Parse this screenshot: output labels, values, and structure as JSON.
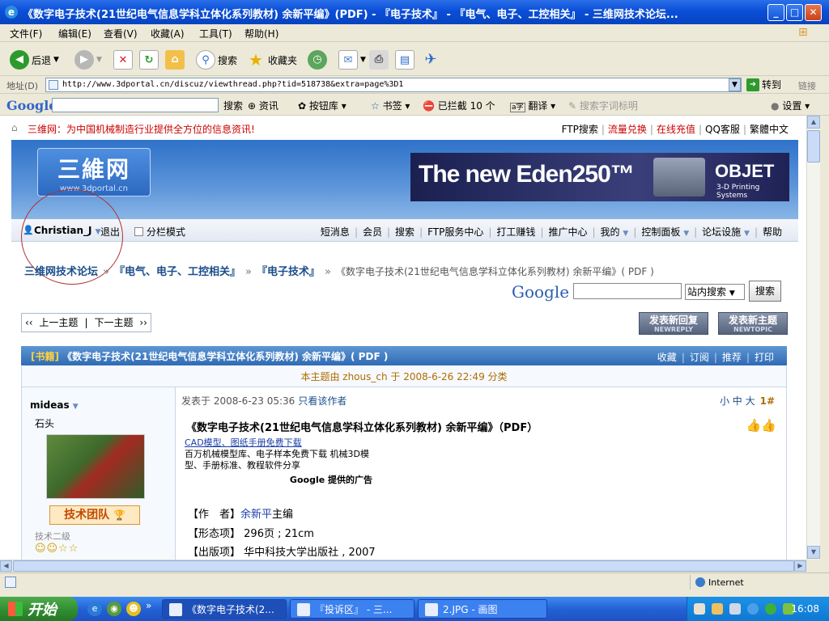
{
  "window": {
    "title": "《数字电子技术(21世纪电气信息学科立体化系列教材) 余新平编》(PDF) - 『电子技术』 - 『电气、电子、工控相关』 - 三维网技术论坛...",
    "min": "_",
    "max": "□",
    "close": "✕"
  },
  "menu": [
    "文件(F)",
    "编辑(E)",
    "查看(V)",
    "收藏(A)",
    "工具(T)",
    "帮助(H)"
  ],
  "toolbar": {
    "back": "后退",
    "search": "搜索",
    "favorites": "收藏夹"
  },
  "address": {
    "label": "地址(D)",
    "url": "http://www.3dportal.cn/discuz/viewthread.php?tid=518738&extra=page%3D1",
    "go": "转到",
    "links": "链接"
  },
  "google_toolbar": {
    "logo": "Google",
    "search": "搜索",
    "news": "资讯",
    "buttons": "按钮库",
    "bookmarks": "书签",
    "blocked": "已拦截 10 个",
    "translate": "翻译",
    "highlight": "搜索字词标明",
    "settings": "设置"
  },
  "site": {
    "slogan": "三维网：为中国机械制造行业提供全方位的信息资讯!",
    "top_links": [
      "FTP搜索",
      "流量兑换",
      "在线充值",
      "QQ客服",
      "繁體中文"
    ],
    "logo_text": "三維网",
    "logo_url": "www.3dportal.cn",
    "ad_headline": "The new Eden250™",
    "ad_brand": "OBJET",
    "ad_sub": "3-D Printing Systems",
    "user": "Christian_J",
    "logout": "退出",
    "split_mode": "分栏模式",
    "nav_links": [
      "短消息",
      "会员",
      "搜索",
      "FTP服务中心",
      "打工赚钱",
      "推广中心",
      "我的",
      "控制面板",
      "论坛设施",
      "帮助"
    ]
  },
  "breadcrumb": {
    "forum": "三维网技术论坛",
    "cat1": "『电气、电子、工控相关』",
    "cat2": "『电子技术』",
    "current": "《数字电子技术(21世纪电气信息学科立体化系列教材) 余新平编》( PDF )"
  },
  "search_box": {
    "logo": "Google",
    "select": "站内搜索",
    "button": "搜索"
  },
  "thread_nav": {
    "prev": "上一主题",
    "next": "下一主题",
    "reply": "发表新回复",
    "reply_en": "NEWREPLY",
    "new_topic": "发表新主题",
    "new_topic_en": "NEWTOPIC"
  },
  "thread": {
    "tag": "[书籍]",
    "title": "《数字电子技术(21世纪电气信息学科立体化系列教材) 余新平编》( PDF )",
    "actions": [
      "收藏",
      "订阅",
      "推荐",
      "打印"
    ],
    "moved": "本主题由 zhous_ch 于 2008-6-26 22:49 分类"
  },
  "poster": {
    "name": "mideas",
    "rank": "石头",
    "team": "技术团队",
    "level": "技术二级"
  },
  "post": {
    "posted": "发表于 2008-6-23 05:36",
    "author_only": "只看该作者",
    "sizes": "小 中 大",
    "floor": "1#",
    "title": "《数字电子技术(21世纪电气信息学科立体化系列教材) 余新平编》（PDF）",
    "ad_link": "CAD模型、图纸手册免费下载",
    "ad_text": "百万机械模型库、电子样本免费下载 机械3D模型、手册标准、教程软件分享",
    "ad_by": "Google 提供的广告",
    "fields": [
      {
        "label": "【作　者】",
        "value": "余新平",
        "value2": "主编"
      },
      {
        "label": "【形态项】",
        "value": "296页 ; 21cm"
      },
      {
        "label": "【出版项】",
        "value": "华中科技大学出版社 , 2007"
      }
    ]
  },
  "status": {
    "zone": "Internet"
  },
  "taskbar": {
    "start": "开始",
    "tasks": [
      "《数字电子技术(2...",
      "『投诉区』 - 三...",
      "2.JPG - 画图"
    ],
    "clock": "16:08"
  }
}
